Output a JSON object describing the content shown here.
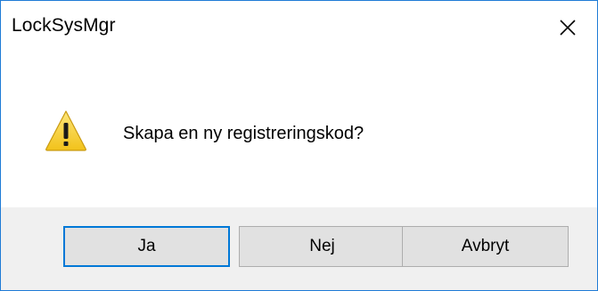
{
  "window": {
    "title": "LockSysMgr",
    "close_icon": "close-icon"
  },
  "dialog": {
    "icon": "warning-icon",
    "message": "Skapa en ny registreringskod?"
  },
  "buttons": {
    "yes_label": "Ja",
    "no_label": "Nej",
    "cancel_label": "Avbryt"
  },
  "colors": {
    "window_border": "#1f7bd6",
    "footer_bg": "#f0f0f0",
    "button_bg": "#e1e1e1",
    "default_button_border": "#0078d7",
    "warning_yellow": "#f6cf2a"
  }
}
